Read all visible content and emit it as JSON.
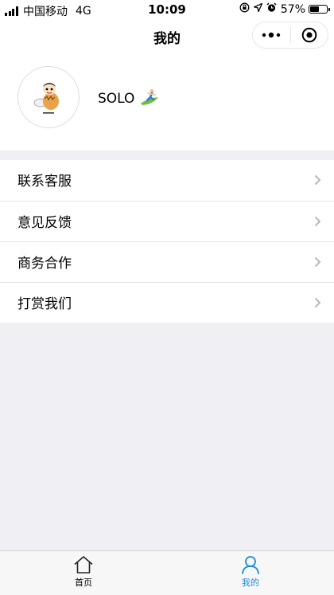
{
  "status_bar": {
    "carrier": "中国移动",
    "network": "4G",
    "time": "10:09",
    "battery_percent": "57%",
    "battery_level": 0.57,
    "icons": [
      "signal-icon",
      "orientation-lock-icon",
      "location-icon",
      "alarm-icon",
      "battery-icon"
    ]
  },
  "nav": {
    "title": "我的",
    "capsule_icons": [
      "more-icon",
      "close-miniprogram-icon"
    ]
  },
  "profile": {
    "name": "SOLO",
    "avatar_icon": "cartoon-avatar-icon",
    "badge_icon": "surfer-emoji-icon"
  },
  "menu": {
    "items": [
      {
        "label": "联系客服"
      },
      {
        "label": "意见反馈"
      },
      {
        "label": "商务合作"
      },
      {
        "label": "打赏我们"
      }
    ],
    "chevron_icon": "chevron-right-icon"
  },
  "tab_bar": {
    "tabs": [
      {
        "label": "首页",
        "icon": "home-icon",
        "active": false
      },
      {
        "label": "我的",
        "icon": "user-icon",
        "active": true
      }
    ],
    "active_color": "#1a8cd8"
  },
  "colors": {
    "background": "#efeff4",
    "surface": "#ffffff",
    "divider": "#e3e3e3",
    "chevron": "#b8b8b8"
  }
}
